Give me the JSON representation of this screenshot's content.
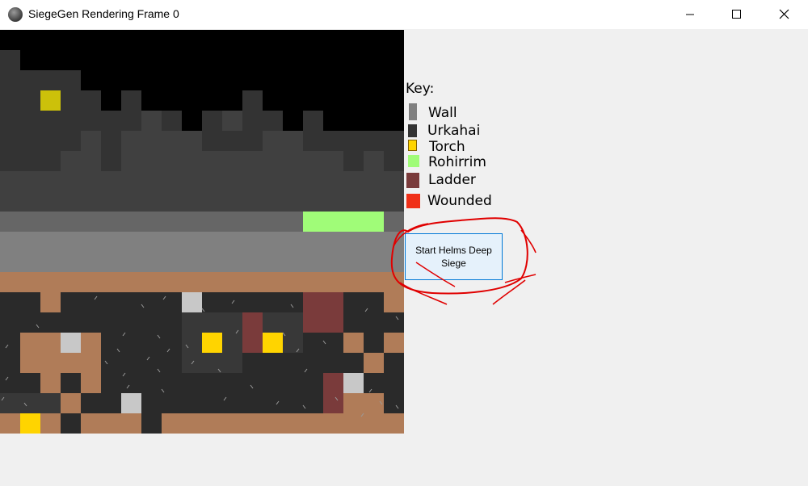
{
  "window": {
    "title": "SiegeGen Rendering Frame 0",
    "icon": "app-icon",
    "controls": [
      "minimize-icon",
      "maximize-icon",
      "close-icon"
    ]
  },
  "key": {
    "title": "Key:",
    "items": [
      {
        "label": "Wall",
        "color": "#808080"
      },
      {
        "label": "Urkahai",
        "color": "#333333"
      },
      {
        "label": "Torch",
        "color": "#ffd400"
      },
      {
        "label": "Rohirrim",
        "color": "#a0fc78"
      },
      {
        "label": "Ladder",
        "color": "#7a3b3b"
      },
      {
        "label": "Wounded",
        "color": "#f03018"
      }
    ]
  },
  "start_button": {
    "label": "Start Helms Deep Siege"
  },
  "colors": {
    "sky": "#000000",
    "wall_dark": "#333333",
    "wall_mid": "#404040",
    "battlement": "#666666",
    "wall_top": "#808080",
    "ground": "#b07c58",
    "urukhai": "#2a2a2a",
    "torch": "#ffd400",
    "rohirrim": "#a0fc78",
    "ladder": "#7a3b3b",
    "rubble": "#c8c8c8",
    "annotation": "#e00000"
  }
}
